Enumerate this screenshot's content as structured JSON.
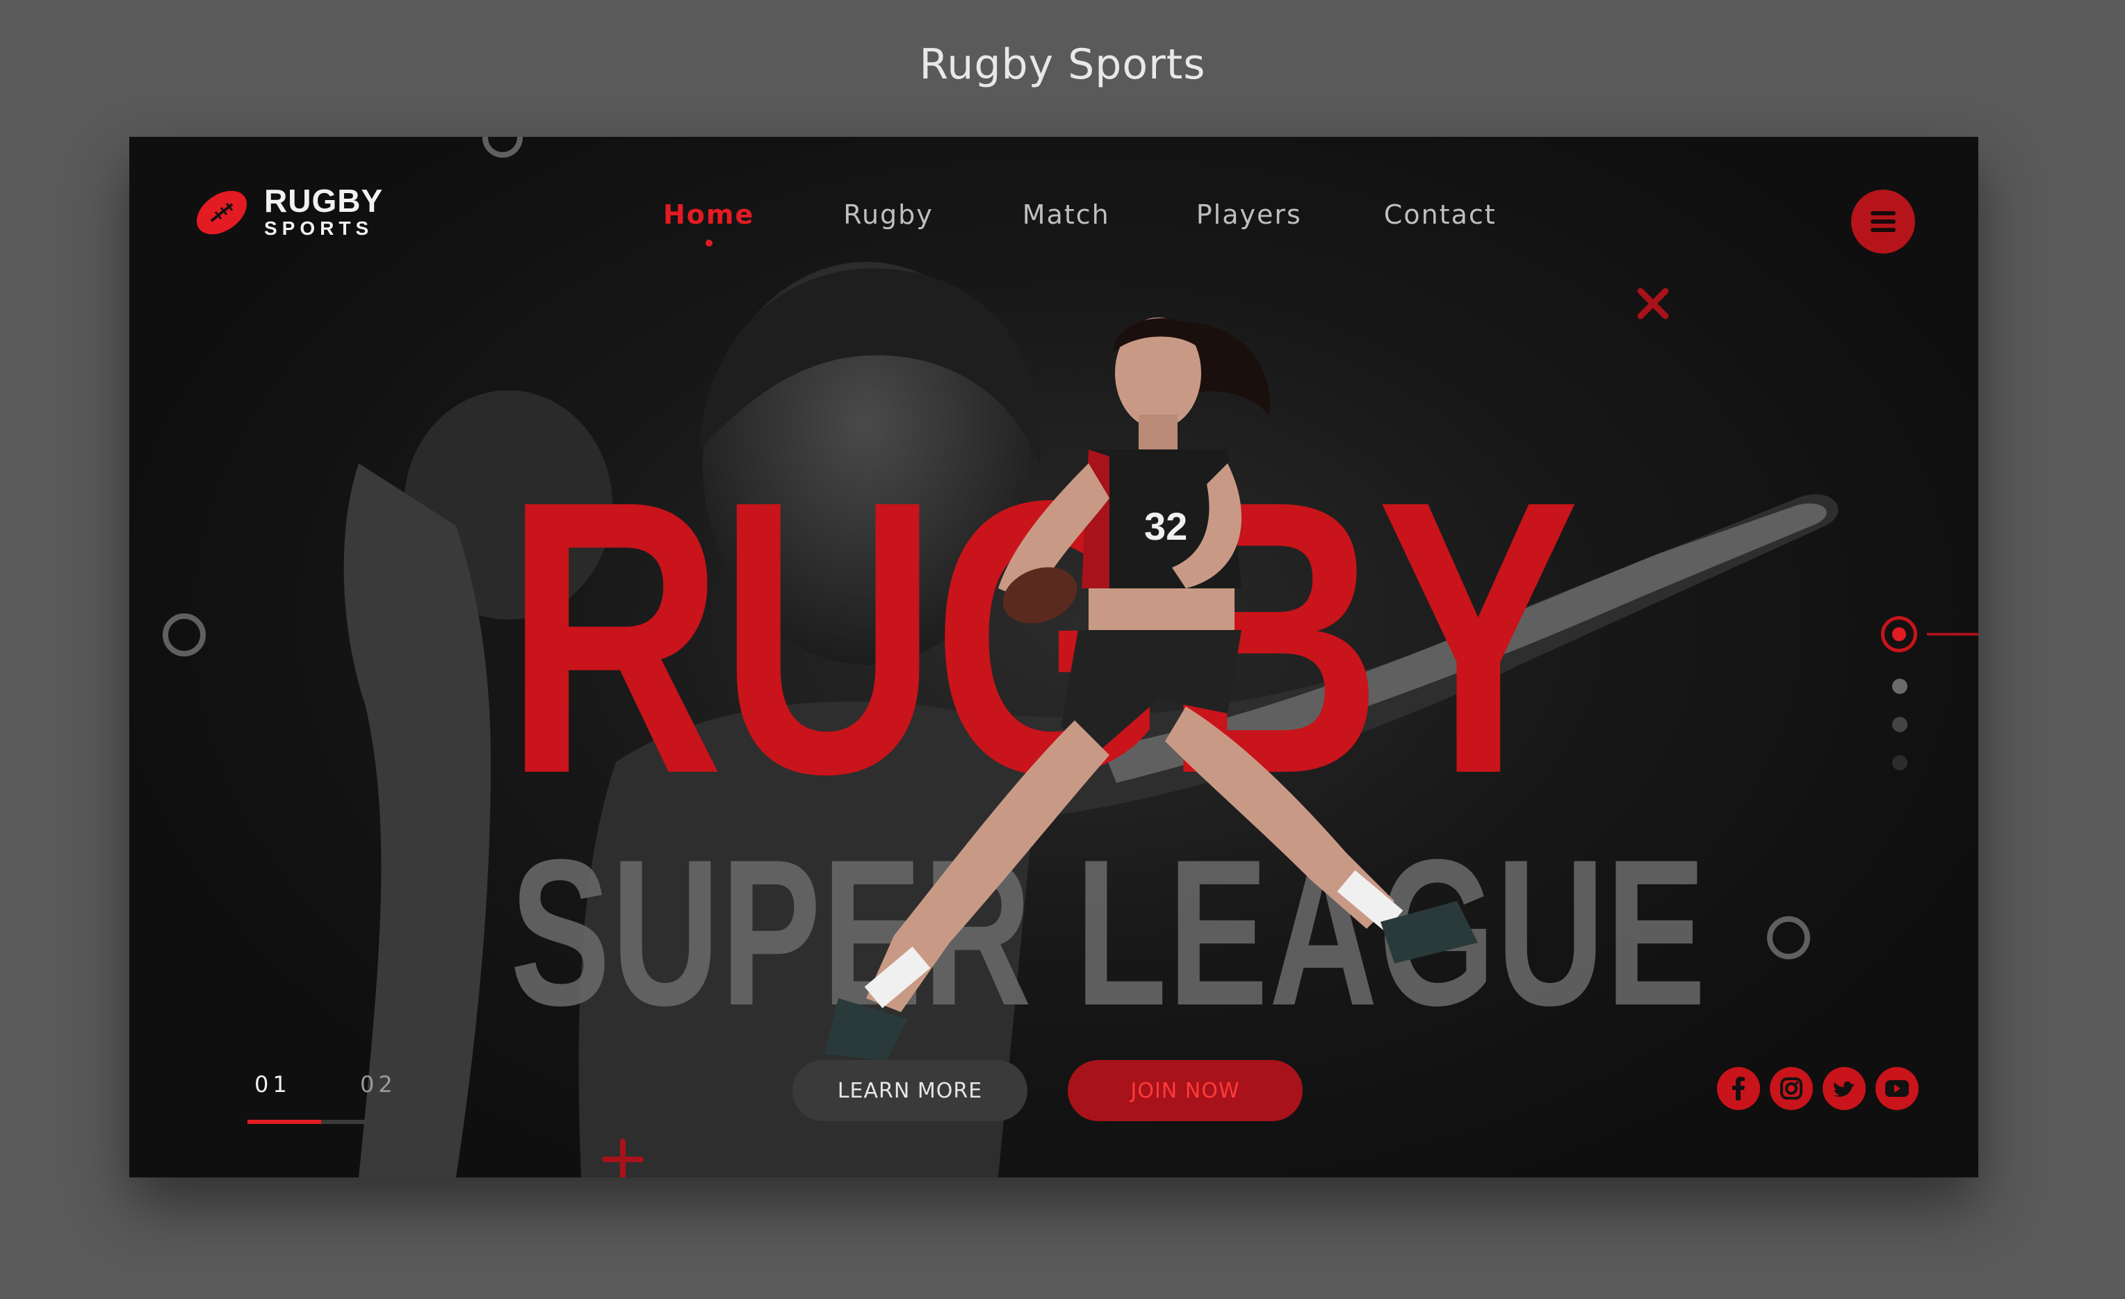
{
  "page": {
    "caption": "Rugby Sports"
  },
  "brand": {
    "line1": "RUGBY",
    "line2": "SPORTS"
  },
  "nav": {
    "items": [
      {
        "label": "Home",
        "active": true
      },
      {
        "label": "Rugby",
        "active": false
      },
      {
        "label": "Match",
        "active": false
      },
      {
        "label": "Players",
        "active": false
      },
      {
        "label": "Contact",
        "active": false
      }
    ]
  },
  "hero": {
    "title": "RUGBY",
    "subtitle": "SUPER LEAGUE",
    "learn_more_label": "LEARN MORE",
    "join_now_label": "JOIN NOW"
  },
  "pager": {
    "current": "01",
    "next": "02",
    "progress": 0.5
  },
  "slides": {
    "count": 4,
    "active_index": 0
  },
  "social": [
    "facebook-icon",
    "instagram-icon",
    "twitter-icon",
    "youtube-icon"
  ],
  "colors": {
    "accent": "#e31b23",
    "dark_accent": "#a8121a",
    "background": "#121212",
    "outer": "#5a5a5a"
  }
}
